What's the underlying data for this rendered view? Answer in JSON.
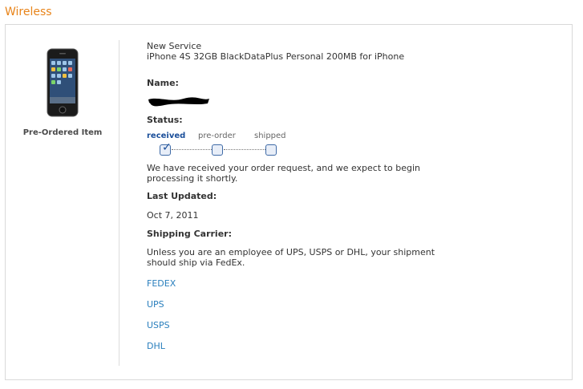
{
  "section": {
    "title": "Wireless"
  },
  "product": {
    "caption": "Pre-Ordered Item",
    "service_type": "New Service",
    "plan": "iPhone 4S 32GB BlackDataPlus Personal 200MB for iPhone"
  },
  "name": {
    "label": "Name:"
  },
  "status": {
    "label": "Status:",
    "steps": [
      {
        "label": "received",
        "active": true
      },
      {
        "label": "pre-order",
        "active": false
      },
      {
        "label": "shipped",
        "active": false
      }
    ],
    "message": "We have received your order request, and we expect to begin processing it shortly."
  },
  "last_updated": {
    "label": "Last Updated:",
    "value": "Oct 7, 2011"
  },
  "shipping": {
    "label": "Shipping Carrier:",
    "message": "Unless you are an employee of UPS, USPS or DHL, your shipment should ship via FedEx.",
    "carriers": [
      "FEDEX",
      "UPS",
      "USPS",
      "DHL"
    ]
  },
  "colors": {
    "accent": "#e8841a",
    "link": "#2a7fbd",
    "status_active": "#1b4f9a"
  }
}
